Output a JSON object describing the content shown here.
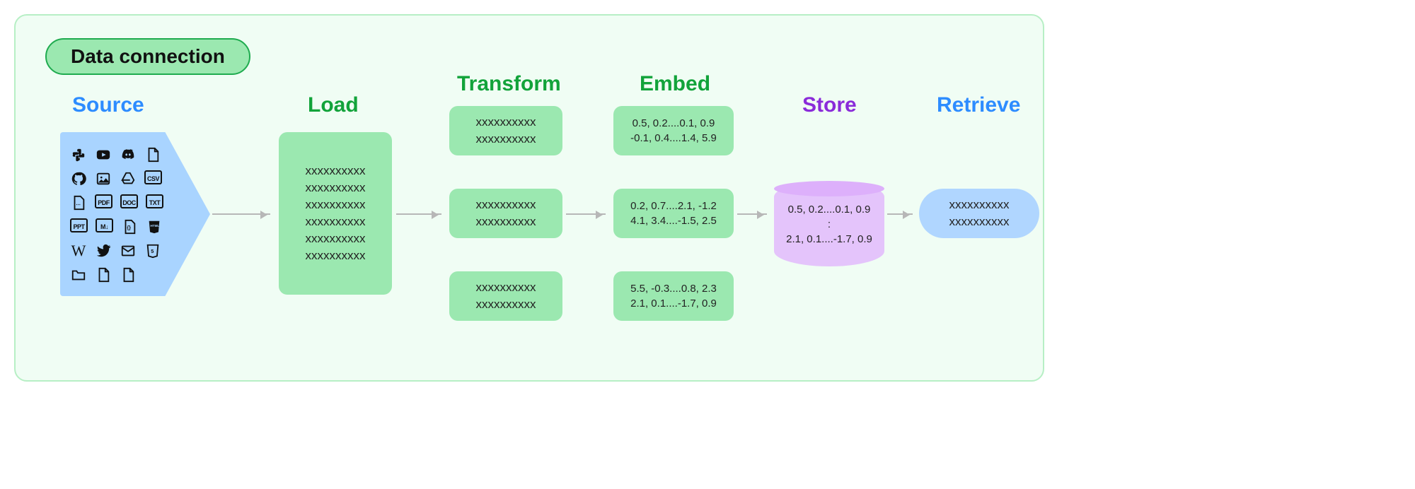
{
  "badge": "Data connection",
  "stages": {
    "source": {
      "title": "Source"
    },
    "load": {
      "title": "Load",
      "lines": [
        "xxxxxxxxxx",
        "xxxxxxxxxx",
        "xxxxxxxxxx",
        "xxxxxxxxxx",
        "xxxxxxxxxx",
        "xxxxxxxxxx"
      ]
    },
    "transform": {
      "title": "Transform",
      "chunks": [
        [
          "xxxxxxxxxx",
          "xxxxxxxxxx"
        ],
        [
          "xxxxxxxxxx",
          "xxxxxxxxxx"
        ],
        [
          "xxxxxxxxxx",
          "xxxxxxxxxx"
        ]
      ]
    },
    "embed": {
      "title": "Embed",
      "chunks": [
        [
          "0.5, 0.2....0.1, 0.9",
          "-0.1, 0.4....1.4, 5.9"
        ],
        [
          "0.2, 0.7....2.1, -1.2",
          "4.1, 3.4....-1.5, 2.5"
        ],
        [
          "5.5, -0.3....0.8, 2.3",
          "2.1, 0.1....-1.7, 0.9"
        ]
      ]
    },
    "store": {
      "title": "Store",
      "lines": [
        "0.5, 0.2....0.1, 0.9",
        ":",
        "2.1, 0.1....-1.7, 0.9"
      ]
    },
    "retrieve": {
      "title": "Retrieve",
      "lines": [
        "xxxxxxxxxx",
        "xxxxxxxxxx"
      ]
    }
  },
  "source_icons": [
    "slack",
    "youtube",
    "discord",
    "file",
    "github",
    "image",
    "gdrive",
    "csv",
    "pdf-file",
    "pdf",
    "doc",
    "txt",
    "ppt",
    "markdown",
    "code",
    "html-shield",
    "wikipedia",
    "twitter",
    "mail",
    "html-tag",
    "folder",
    "file2",
    "file3"
  ]
}
